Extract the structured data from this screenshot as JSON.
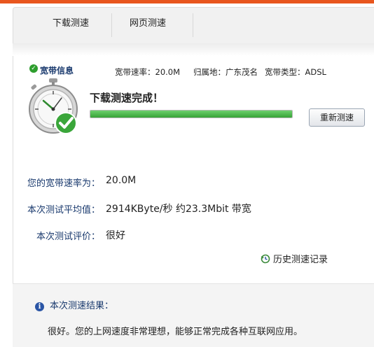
{
  "tabs": [
    {
      "label": "下载测速"
    },
    {
      "label": "网页测速"
    }
  ],
  "info": {
    "title": "宽带信息",
    "rate_label": "宽带速率：20.0M",
    "location_label": "归属地：广东茂名",
    "type_label": "宽带类型：ADSL"
  },
  "status": {
    "title": "下载测速完成！",
    "progress_percent": 100,
    "retest_button": "重新测速"
  },
  "results": [
    {
      "label": "您的宽带速率为：",
      "value": "20.0M"
    },
    {
      "label": "本次测试平均值：",
      "value": "2914KByte/秒 约23.3Mbit 带宽"
    },
    {
      "label": "本次测试评价：",
      "value": "很好"
    }
  ],
  "history_link": "历史测速记录",
  "conclusion": {
    "title": "本次测速结果：",
    "text": "很好。您的上网速度非常理想，能够正常完成各种互联网应用。"
  },
  "colors": {
    "accent_top": "#e8561e",
    "label_blue": "#1a3a6e",
    "progress_green": "#37a337"
  }
}
